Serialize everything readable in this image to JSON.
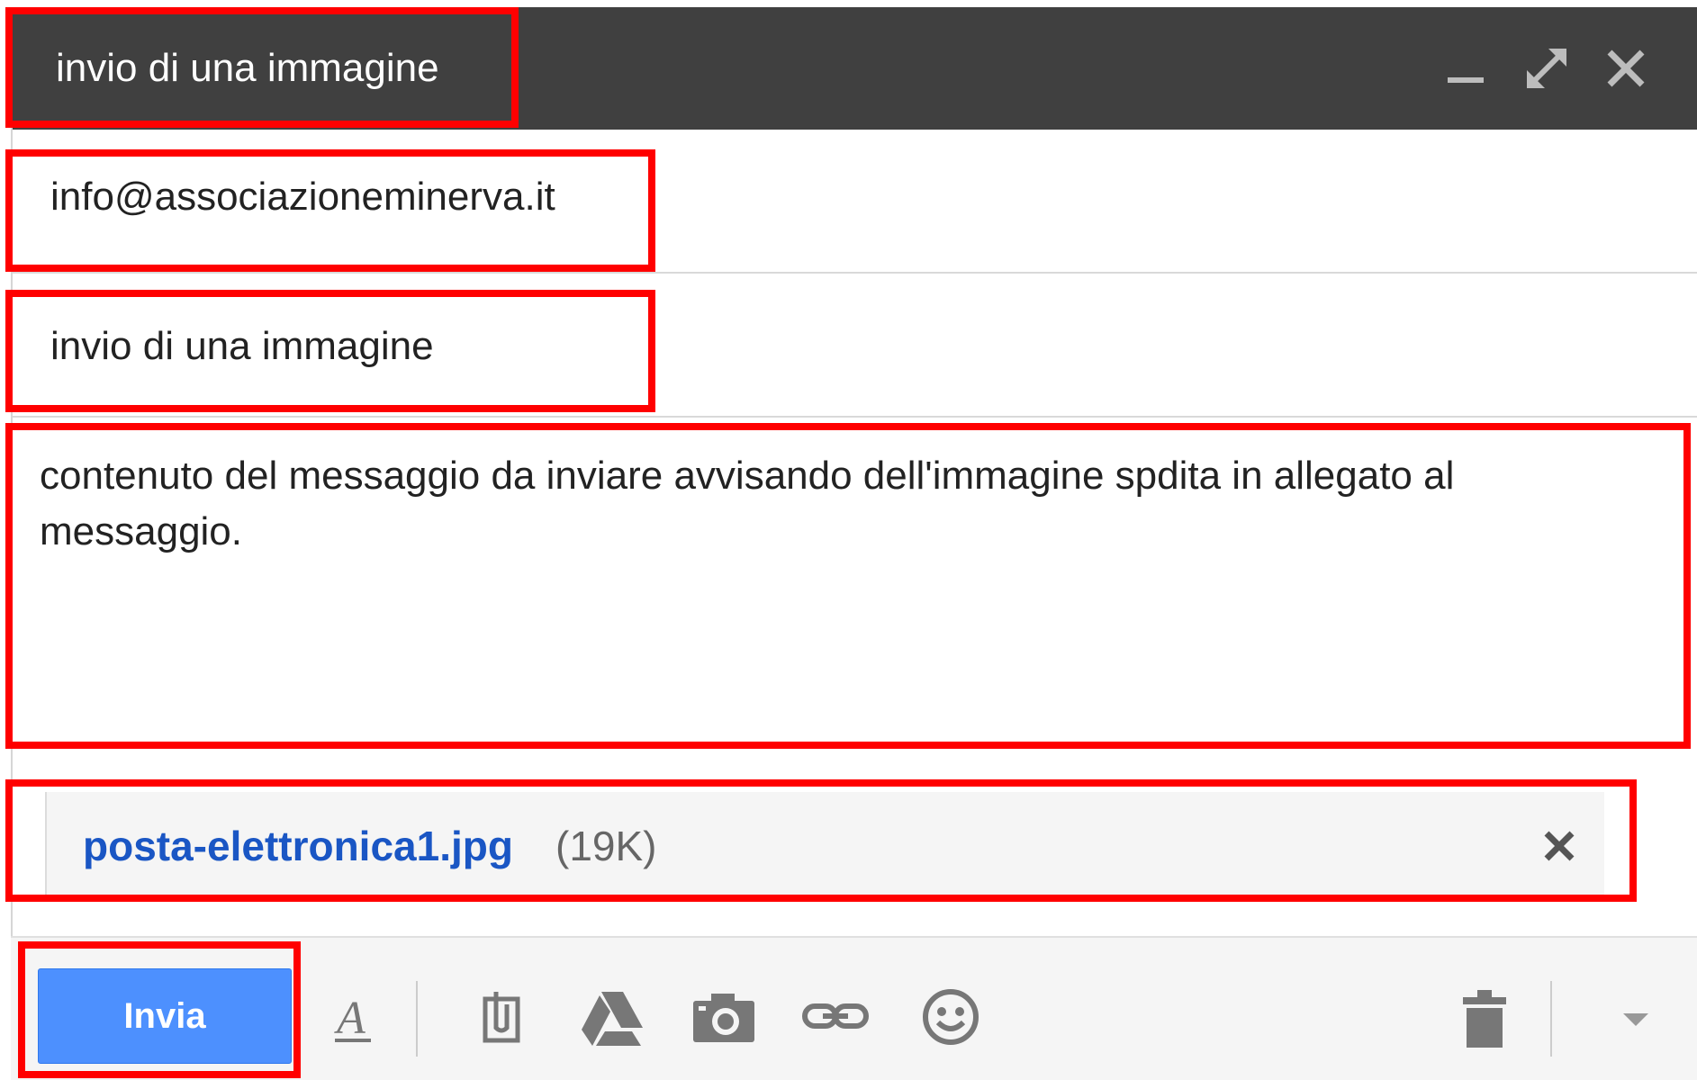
{
  "window": {
    "title": "invio di una immagine"
  },
  "title_controls": {
    "minimize_icon": "minimize-icon",
    "expand_icon": "expand-icon",
    "close_icon": "close-icon"
  },
  "fields": {
    "to": "info@associazioneminerva.it",
    "subject": "invio di una immagine"
  },
  "message": {
    "body": "contenuto del messaggio da inviare avvisando dell'immagine spdita in allegato al messaggio."
  },
  "attachment": {
    "name": "posta-elettronica1.jpg",
    "size": "(19K)"
  },
  "toolbar": {
    "send_label": "Invia",
    "icons": [
      "formatting-icon",
      "attach-icon",
      "drive-icon",
      "photo-icon",
      "link-icon",
      "emoji-icon",
      "trash-icon",
      "more-options-icon"
    ]
  },
  "colors": {
    "titlebar": "#404040",
    "send_button": "#4d90fe",
    "attachment_link": "#1a56c4",
    "annotation": "#ff0000"
  }
}
